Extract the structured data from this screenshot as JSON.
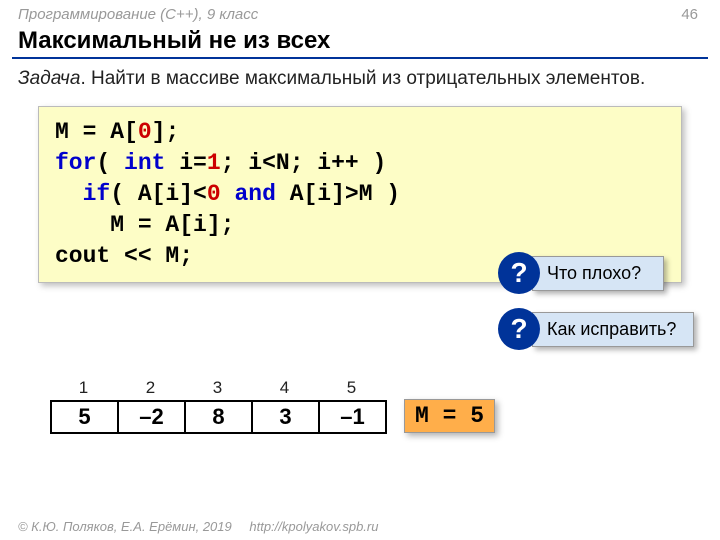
{
  "header": {
    "context": "Программирование (C++), 9 класс",
    "page": "46"
  },
  "title": "Максимальный не из всех",
  "task": {
    "label": "Задача",
    "text": ". Найти в массиве максимальный из отрицательных элементов."
  },
  "code": {
    "l1a": "M = A[",
    "l1b": "0",
    "l1c": "];",
    "l2a": "for",
    "l2b": "( ",
    "l2c": "int",
    "l2d": " i=",
    "l2e": "1",
    "l2f": "; i<N; i++ )",
    "l3a": "  ",
    "l3b": "if",
    "l3c": "( A[i]<",
    "l3d": "0",
    "l3e": " ",
    "l3f": "and",
    "l3g": " A[i]>M )",
    "l4": "    M = A[i];",
    "l5": "cout << M;"
  },
  "callouts": {
    "q": "?",
    "c1": "Что плохо?",
    "c2": "Как исправить?"
  },
  "array": {
    "idx": [
      "1",
      "2",
      "3",
      "4",
      "5"
    ],
    "vals": [
      "5",
      "–2",
      "8",
      "3",
      "–1"
    ]
  },
  "result": "M = 5",
  "footer": {
    "copy": "© К.Ю. Поляков, Е.А. Ерёмин, 2019",
    "url": "http://kpolyakov.spb.ru"
  }
}
